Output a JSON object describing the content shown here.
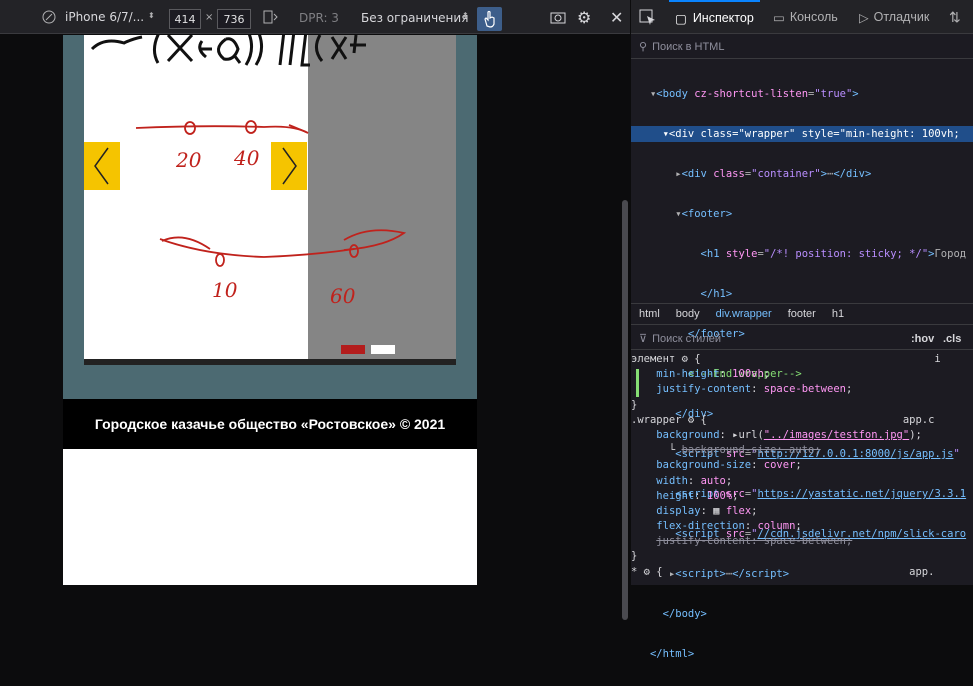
{
  "toolbar": {
    "device": "iPhone 6/7/...",
    "width": "414",
    "x": "×",
    "height": "736",
    "dpr": "DPR: 3",
    "throttle": "Без ограничения"
  },
  "devtools": {
    "tabs": [
      "Инспектор",
      "Консоль",
      "Отладчик"
    ],
    "search_placeholder": "Поиск в HTML",
    "crumbs": [
      "html",
      "body",
      "div.wrapper",
      "footer",
      "h1"
    ],
    "styles_filter": "Поиск стилей",
    "hov": ":hov",
    "cls": ".cls"
  },
  "page": {
    "footer_text": "Городское казачье общество «Ростовское» © 2021",
    "slide_numbers": [
      "20",
      "40",
      "10",
      "60"
    ]
  },
  "colors": {
    "accent": "#f5c400",
    "dot_active": "#b31d1d",
    "dot": "#ffffff"
  }
}
